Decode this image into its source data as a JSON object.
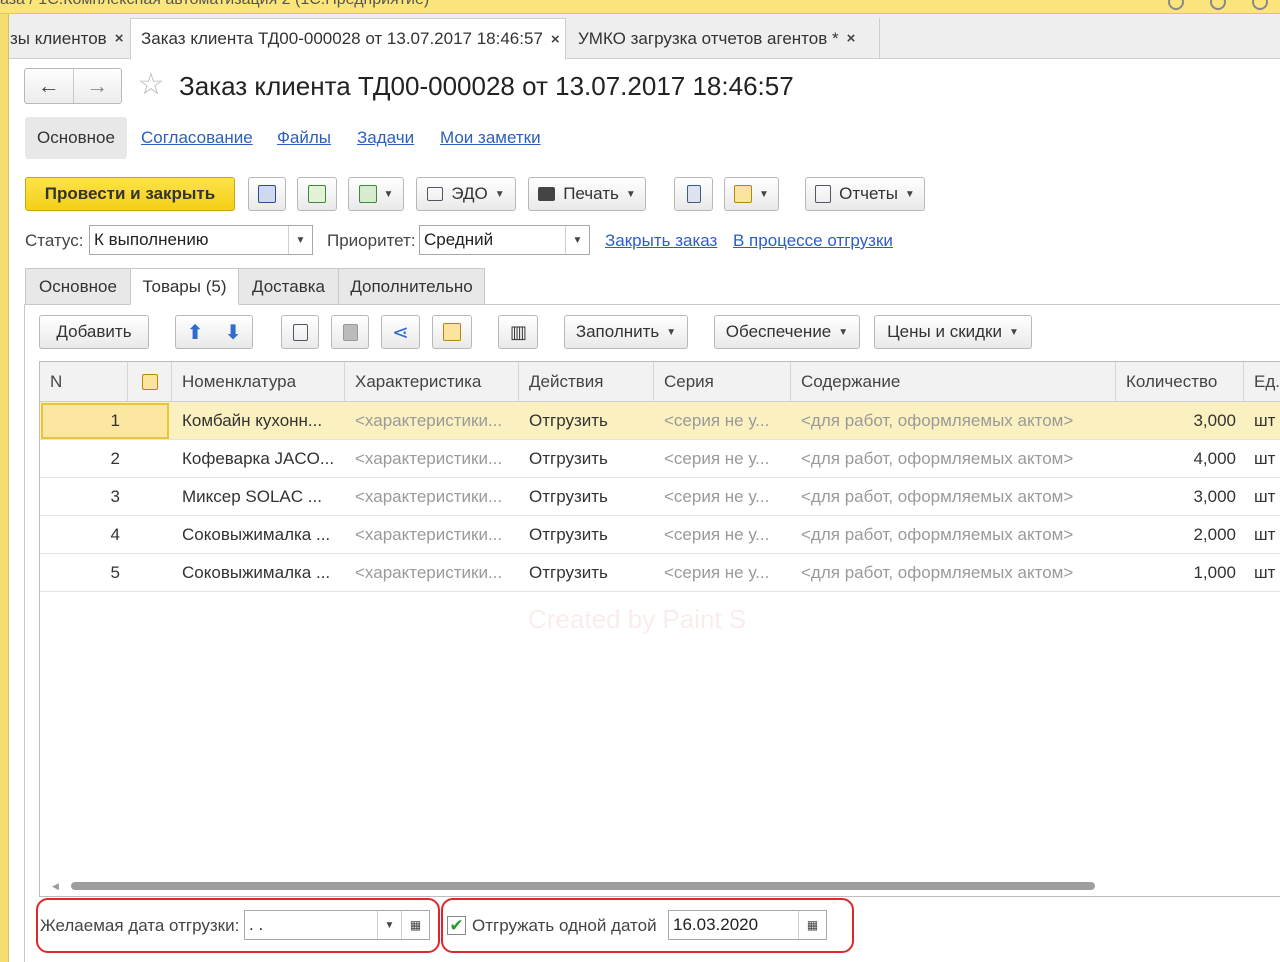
{
  "window": {
    "title": "аза / 1С:Комплексная автоматизация 2 (1С:Предприятие)"
  },
  "tabs": [
    {
      "label": "зы клиентов",
      "close": "×"
    },
    {
      "label": "Заказ клиента ТД00-000028 от 13.07.2017 18:46:57",
      "close": "×"
    },
    {
      "label": "УМКО загрузка отчетов агентов *",
      "close": "×"
    }
  ],
  "nav": {
    "back": "←",
    "forward": "→",
    "star": "☆"
  },
  "document": {
    "title": "Заказ клиента ТД00-000028 от 13.07.2017 18:46:57"
  },
  "sections": {
    "active": "Основное",
    "links": [
      "Согласование",
      "Файлы",
      "Задачи",
      "Мои заметки"
    ]
  },
  "toolbar": {
    "post_close": "Провести и закрыть",
    "edo": "ЭДО",
    "print": "Печать",
    "reports": "Отчеты",
    "dropdown": "▼"
  },
  "status": {
    "label": "Статус:",
    "value": "К выполнению",
    "priority_label": "Приоритет:",
    "priority_value": "Средний",
    "close_order": "Закрыть заказ",
    "shipping_state": "В процессе отгрузки"
  },
  "inner_tabs": [
    "Основное",
    "Товары (5)",
    "Доставка",
    "Дополнительно"
  ],
  "goods_toolbar": {
    "add": "Добавить",
    "fill": "Заполнить",
    "supply": "Обеспечение",
    "prices": "Цены и скидки"
  },
  "table": {
    "headers": [
      "N",
      "",
      "Номенклатура",
      "Характеристика",
      "Действия",
      "Серия",
      "Содержание",
      "Количество",
      "Ед."
    ],
    "rows": [
      {
        "n": "1",
        "item": "Комбайн кухонн...",
        "char": "<характеристики...",
        "action": "Отгрузить",
        "series": "<серия не у...",
        "content": "<для работ, оформляемых актом>",
        "qty": "3,000",
        "unit": "шт"
      },
      {
        "n": "2",
        "item": "Кофеварка JACO...",
        "char": "<характеристики...",
        "action": "Отгрузить",
        "series": "<серия не у...",
        "content": "<для работ, оформляемых актом>",
        "qty": "4,000",
        "unit": "шт"
      },
      {
        "n": "3",
        "item": "Миксер SOLAC ...",
        "char": "<характеристики...",
        "action": "Отгрузить",
        "series": "<серия не у...",
        "content": "<для работ, оформляемых актом>",
        "qty": "3,000",
        "unit": "шт"
      },
      {
        "n": "4",
        "item": "Соковыжималка ...",
        "char": "<характеристики...",
        "action": "Отгрузить",
        "series": "<серия не у...",
        "content": "<для работ, оформляемых актом>",
        "qty": "2,000",
        "unit": "шт"
      },
      {
        "n": "5",
        "item": "Соковыжималка ...",
        "char": "<характеристики...",
        "action": "Отгрузить",
        "series": "<серия не у...",
        "content": "<для работ, оформляемых актом>",
        "qty": "1,000",
        "unit": "шт"
      }
    ]
  },
  "bottom": {
    "desired_date_label": "Желаемая дата отгрузки:",
    "desired_date_value": " .  .",
    "one_date_label": "Отгружать одной датой",
    "one_date_checked": "✔",
    "one_date_value": "16.03.2020"
  },
  "watermark": "Created by Paint S"
}
